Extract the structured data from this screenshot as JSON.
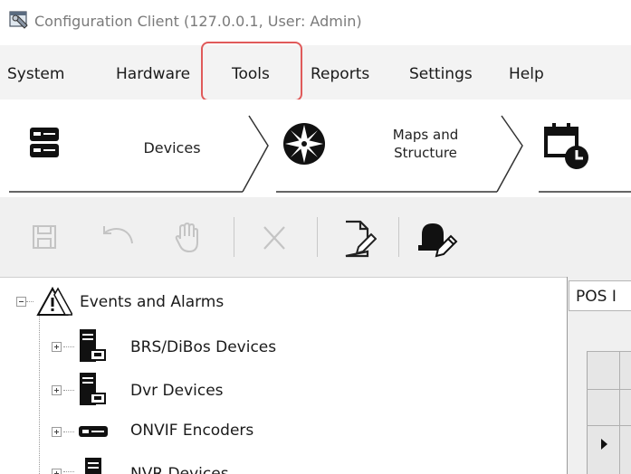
{
  "window": {
    "title": "Configuration Client (127.0.0.1, User: Admin)",
    "app_icon": "configuration-client-icon"
  },
  "menu": {
    "items": [
      {
        "label": "System"
      },
      {
        "label": "Hardware"
      },
      {
        "label": "Tools"
      },
      {
        "label": "Reports"
      },
      {
        "label": "Settings"
      },
      {
        "label": "Help"
      }
    ],
    "highlighted": "Tools",
    "highlight_color": "#e05a5a"
  },
  "ribbon": {
    "items": [
      {
        "label": "Devices",
        "icon": "server-icon"
      },
      {
        "label_line1": "Maps and",
        "label_line2": "Structure",
        "icon": "compass-icon"
      },
      {
        "icon": "calendar-clock-icon"
      }
    ]
  },
  "toolbar": {
    "buttons": [
      {
        "icon": "save-icon",
        "enabled": false
      },
      {
        "icon": "undo-icon",
        "enabled": false
      },
      {
        "icon": "hand-icon",
        "enabled": false
      },
      {
        "icon": "delete-icon",
        "enabled": false
      },
      {
        "icon": "edit-page-icon",
        "enabled": true
      },
      {
        "icon": "alarm-edit-icon",
        "enabled": true
      }
    ]
  },
  "tree": {
    "root": {
      "label": "Events and Alarms",
      "icon": "warning-triangle-icon",
      "expanded": true
    },
    "children": [
      {
        "label": "BRS/DiBos Devices",
        "icon": "device-tower-icon"
      },
      {
        "label": "Dvr Devices",
        "icon": "device-tower-icon"
      },
      {
        "label": "ONVIF Encoders",
        "icon": "encoder-icon"
      },
      {
        "label": "NVR Devices",
        "icon": "device-tower-icon"
      }
    ]
  },
  "right_panel": {
    "tab_label": "POS I"
  }
}
